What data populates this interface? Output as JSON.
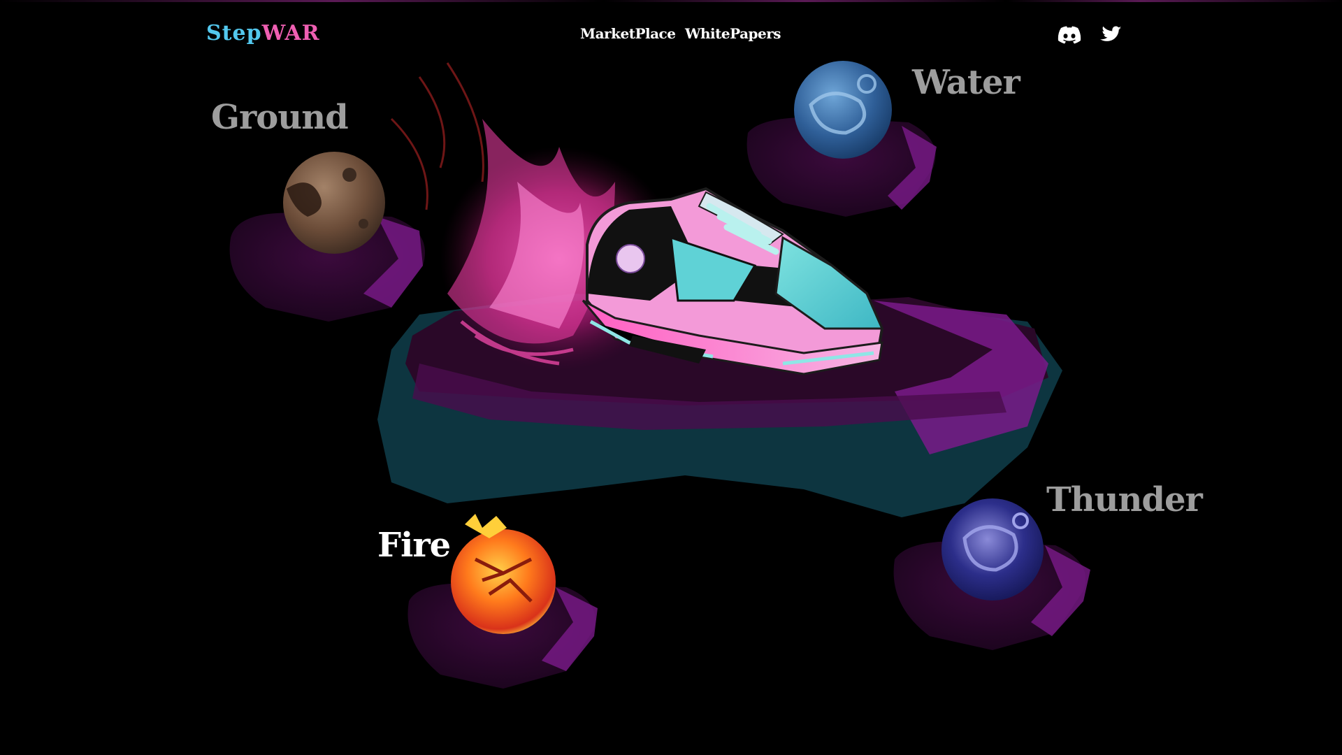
{
  "header": {
    "logo": {
      "part1": "Step",
      "part2": "WAR"
    },
    "nav": [
      {
        "label": "MarketPlace"
      },
      {
        "label": "WhitePapers"
      }
    ],
    "social": [
      {
        "icon": "discord-icon"
      },
      {
        "icon": "twitter-icon"
      }
    ]
  },
  "hero": {
    "elements": [
      {
        "name": "Ground",
        "color": "#9d9d9d"
      },
      {
        "name": "Water",
        "color": "#9d9d9d"
      },
      {
        "name": "Fire",
        "color": "#ffffff"
      },
      {
        "name": "Thunder",
        "color": "#9d9d9d"
      }
    ]
  },
  "colors": {
    "background": "#000000",
    "logo_primary": "#53c8ee",
    "logo_secondary": "#ef5fb2",
    "accent_pink": "#ff3fb0",
    "accent_purple": "#7a1a8a",
    "accent_teal": "#0f3a42",
    "shoe_cyan": "#5fd2d6",
    "shoe_pink": "#f39ad8"
  }
}
